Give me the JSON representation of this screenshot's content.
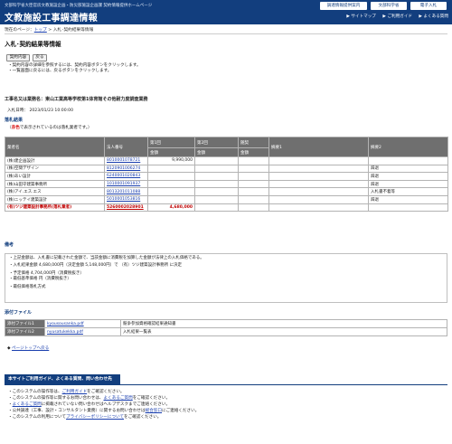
{
  "header": {
    "subtitle": "文部科学省大臣官房文教施設企画・防災部施設企画課 契約情報提供ホームページ",
    "title": "文教施設工事調達情報",
    "btn_tender": "調達情報提供案内",
    "btn_mext": "文部科学省",
    "btn_ebid": "電子入札",
    "link_sitemap": "サイトマップ",
    "link_guide": "ご利用ガイド",
    "link_faq": "よくある質問"
  },
  "breadcrumb": {
    "prefix": "現在のページ：",
    "top": "トップ",
    "sep": " > ",
    "current": "入札･契約結果等情報"
  },
  "page_title": "入札･契約結果等情報",
  "buttons": {
    "contract_info": "契約内容",
    "back": "戻る"
  },
  "notes": [
    "・契約内容の詳細を参照するには、契約内容ボタンをクリックします。",
    "・一覧画面に戻るには、戻るボタンをクリックします。"
  ],
  "project": {
    "label": "工事名又は業務名：",
    "name": "東山工業高等学校第1体育館その他耐力度調査業務"
  },
  "bid_date": {
    "label": "入札日時：",
    "value": "2023/01/23 10:00:00"
  },
  "result_section": {
    "title": "落札結果",
    "legend_prefix": "（",
    "legend_red": "赤色",
    "legend_suffix": "で表示されているのは落札業者です。）",
    "headers": {
      "bidder": "業者名",
      "corp_no": "法人番号",
      "round1": "第1回",
      "round2": "第2回",
      "reason_header": "随契",
      "amount": "金額",
      "note1": "摘要1",
      "note2": "摘要2"
    },
    "rows": [
      {
        "name": "(株)建企画設計",
        "corp_no": "8010001078721",
        "r1": "9,990,000",
        "r2": "",
        "r3": "",
        "note1": "",
        "note2": "",
        "winner": false
      },
      {
        "name": "(株)空間デザイン",
        "corp_no": "8120901006274",
        "r1": "",
        "r2": "",
        "r3": "",
        "note1": "",
        "note2": "辞退",
        "winner": false
      },
      {
        "name": "(株)あい設計",
        "corp_no": "6240001020843",
        "r1": "",
        "r2": "",
        "r3": "",
        "note1": "",
        "note2": "辞退",
        "winner": false
      },
      {
        "name": "(株)山田守建築事務所",
        "corp_no": "1010001091937",
        "r1": "",
        "r2": "",
        "r3": "",
        "note1": "",
        "note2": "辞退",
        "winner": false
      },
      {
        "name": "(株)アイ.エス.エス",
        "corp_no": "8013201011088",
        "r1": "",
        "r2": "",
        "r3": "",
        "note1": "",
        "note2": "入札書不着等",
        "winner": false
      },
      {
        "name": "(株)ニッテイ建築設計",
        "corp_no": "5010001053816",
        "r1": "",
        "r2": "",
        "r3": "",
        "note1": "",
        "note2": "辞退",
        "winner": false
      },
      {
        "name": "(有)ツジ建築設計事務所(落札業者)",
        "corp_no": "5260002028901",
        "r1": "4,680,000",
        "r2": "",
        "r3": "",
        "note1": "",
        "note2": "",
        "winner": true
      }
    ]
  },
  "remarks_section": {
    "title": "備考",
    "lines": [
      "・上記金額は、入札書に記載された金額で、当該金額に消費税を加算した金額が法律上の入札価格である。",
      "・入札結果金額 4,680,000円（決定金額 5,148,000円）で （有）ツジ建築設計事務所 に決定",
      "・予定価格 4,704,000円（消費税抜き）",
      "・最低基準価格 円（消費税抜き）",
      "・最低価格落札方式"
    ]
  },
  "attachments_section": {
    "title": "添付ファイル",
    "files": [
      {
        "label": "添付ファイル1",
        "file": "kyousousanka.pdf",
        "desc": "競争参加資格確認結果通知書"
      },
      {
        "label": "添付ファイル2",
        "file": "nyusatukekka.pdf",
        "desc": "入札結果一覧表"
      }
    ]
  },
  "page_top": "ページトップへ戻る",
  "footer": {
    "bar_title": "本サイトご利用ガイド、よくある質問、問い合わせ先",
    "lines": [
      {
        "a": "・このシステムの操作等は、",
        "link": "ご利用ガイド",
        "b": "をご確認ください。"
      },
      {
        "a": "・このシステムの操作等に関するお問い合わせは、",
        "link": "よくあるご質問",
        "b": "をご確認ください。"
      },
      {
        "a": "・",
        "link": "よくあるご質問",
        "b": "に掲載されていない問い合わせはヘルプデスクまでご連絡ください。"
      },
      {
        "a": "・公共調達（工事、設計・コンサルタント業務）に関するお問い合わせは",
        "link": "総合窓口",
        "b": "にご連絡ください。"
      },
      {
        "a": "・このシステムの利用について",
        "link": "プライバシーポリシーについて",
        "b": "をご確認ください。"
      }
    ]
  }
}
